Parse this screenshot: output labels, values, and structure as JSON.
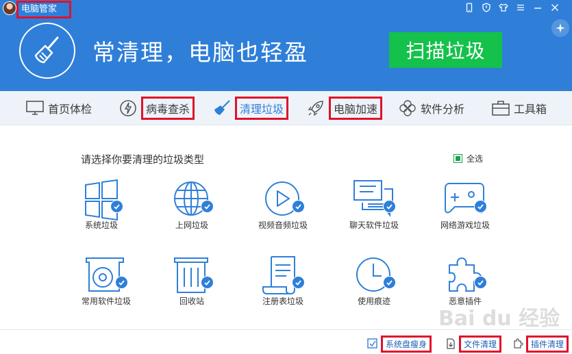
{
  "app": {
    "title": "电脑管家"
  },
  "banner": {
    "slogan": "常清理，电脑也轻盈",
    "scan_button": "扫描垃圾"
  },
  "nav": {
    "items": [
      {
        "label": "首页体检",
        "icon": "monitor-icon"
      },
      {
        "label": "病毒查杀",
        "icon": "bolt-icon"
      },
      {
        "label": "清理垃圾",
        "icon": "broom-icon"
      },
      {
        "label": "电脑加速",
        "icon": "rocket-icon"
      },
      {
        "label": "软件分析",
        "icon": "flower-icon"
      },
      {
        "label": "工具箱",
        "icon": "toolbox-icon"
      }
    ]
  },
  "main": {
    "section_title": "请选择你要清理的垃圾类型",
    "select_all": "全选",
    "categories": [
      {
        "label": "系统垃圾",
        "icon": "windows-icon"
      },
      {
        "label": "上网垃圾",
        "icon": "globe-icon"
      },
      {
        "label": "视频音频垃圾",
        "icon": "play-icon"
      },
      {
        "label": "聊天软件垃圾",
        "icon": "chat-icon"
      },
      {
        "label": "网络游戏垃圾",
        "icon": "gamepad-icon"
      },
      {
        "label": "常用软件垃圾",
        "icon": "disc-icon"
      },
      {
        "label": "回收站",
        "icon": "trash-icon"
      },
      {
        "label": "注册表垃圾",
        "icon": "registry-icon"
      },
      {
        "label": "使用痕迹",
        "icon": "clock-icon"
      },
      {
        "label": "恶意插件",
        "icon": "puzzle-icon"
      }
    ]
  },
  "footer": {
    "items": [
      {
        "label": "系统盘瘦身",
        "icon": "disk-icon"
      },
      {
        "label": "文件清理",
        "icon": "file-icon"
      },
      {
        "label": "插件清理",
        "icon": "plugin-icon"
      }
    ]
  },
  "watermark": "Bai du 经验",
  "colors": {
    "brand_blue": "#2f7fd9",
    "scan_green": "#14c14b",
    "highlight_red": "#e0112b"
  }
}
